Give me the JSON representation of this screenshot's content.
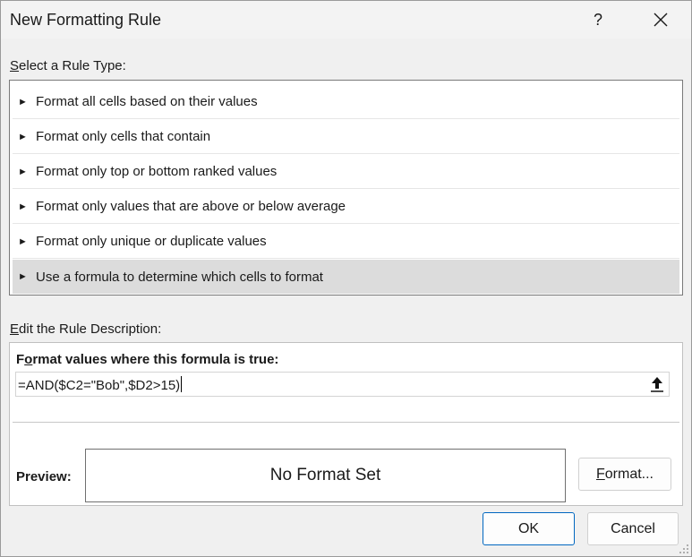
{
  "dialog": {
    "title": "New Formatting Rule",
    "help_label": "?"
  },
  "rule_type": {
    "label_prefix": "",
    "label_accel": "S",
    "label_rest": "elect a Rule Type:",
    "items": [
      {
        "label": "Format all cells based on their values",
        "selected": false
      },
      {
        "label": "Format only cells that contain",
        "selected": false
      },
      {
        "label": "Format only top or bottom ranked values",
        "selected": false
      },
      {
        "label": "Format only values that are above or below average",
        "selected": false
      },
      {
        "label": "Format only unique or duplicate values",
        "selected": false
      },
      {
        "label": "Use a formula to determine which cells to format",
        "selected": true
      }
    ]
  },
  "description": {
    "label_accel": "E",
    "label_rest": "dit the Rule Description:",
    "formula_label_pre": "F",
    "formula_label_accel": "o",
    "formula_label_rest": "rmat values where this formula is true:",
    "formula_value": "=AND($C2=\"Bob\",$D2>15)",
    "preview_label": "Preview:",
    "preview_text": "No Format Set",
    "format_button_accel": "F",
    "format_button_rest": "ormat..."
  },
  "buttons": {
    "ok": "OK",
    "cancel": "Cancel"
  },
  "icons": {
    "help": "help-icon",
    "close": "close-icon",
    "collapse": "collapse-dialog-icon",
    "arrow": "triangle-right-icon",
    "grip": "resize-grip-icon"
  }
}
